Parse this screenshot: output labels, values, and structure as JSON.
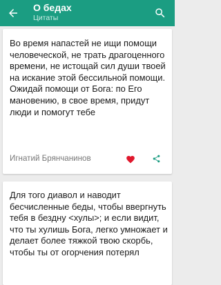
{
  "appbar": {
    "title": "О бедах",
    "subtitle": "Цитаты",
    "back_icon": "arrow-back-icon",
    "search_icon": "search-icon"
  },
  "colors": {
    "primary": "#1b9d82",
    "heart": "#e0182d",
    "share": "#1b9d82"
  },
  "quotes": [
    {
      "text": "Во время напастей не ищи помощи человеческой, не трать драгоценного времени, не истощай сил души твоей на искание этой бессильной помощи. Ожидай помощи от Бога: по Его мановению, в свое время, придут люди и помогут тебе",
      "author": "Игнатий Брянчанинов",
      "favorite_icon": "heart-icon",
      "share_icon": "share-icon"
    },
    {
      "text": "Для того диавол и наводит бесчисленные беды, чтобы ввергнуть тебя в бездну <хулы>; и если видит, что ты хулишь Бога, легко умножает и делает более тяжкой твою скорбь, чтобы ты от огорчения потерял"
    }
  ]
}
